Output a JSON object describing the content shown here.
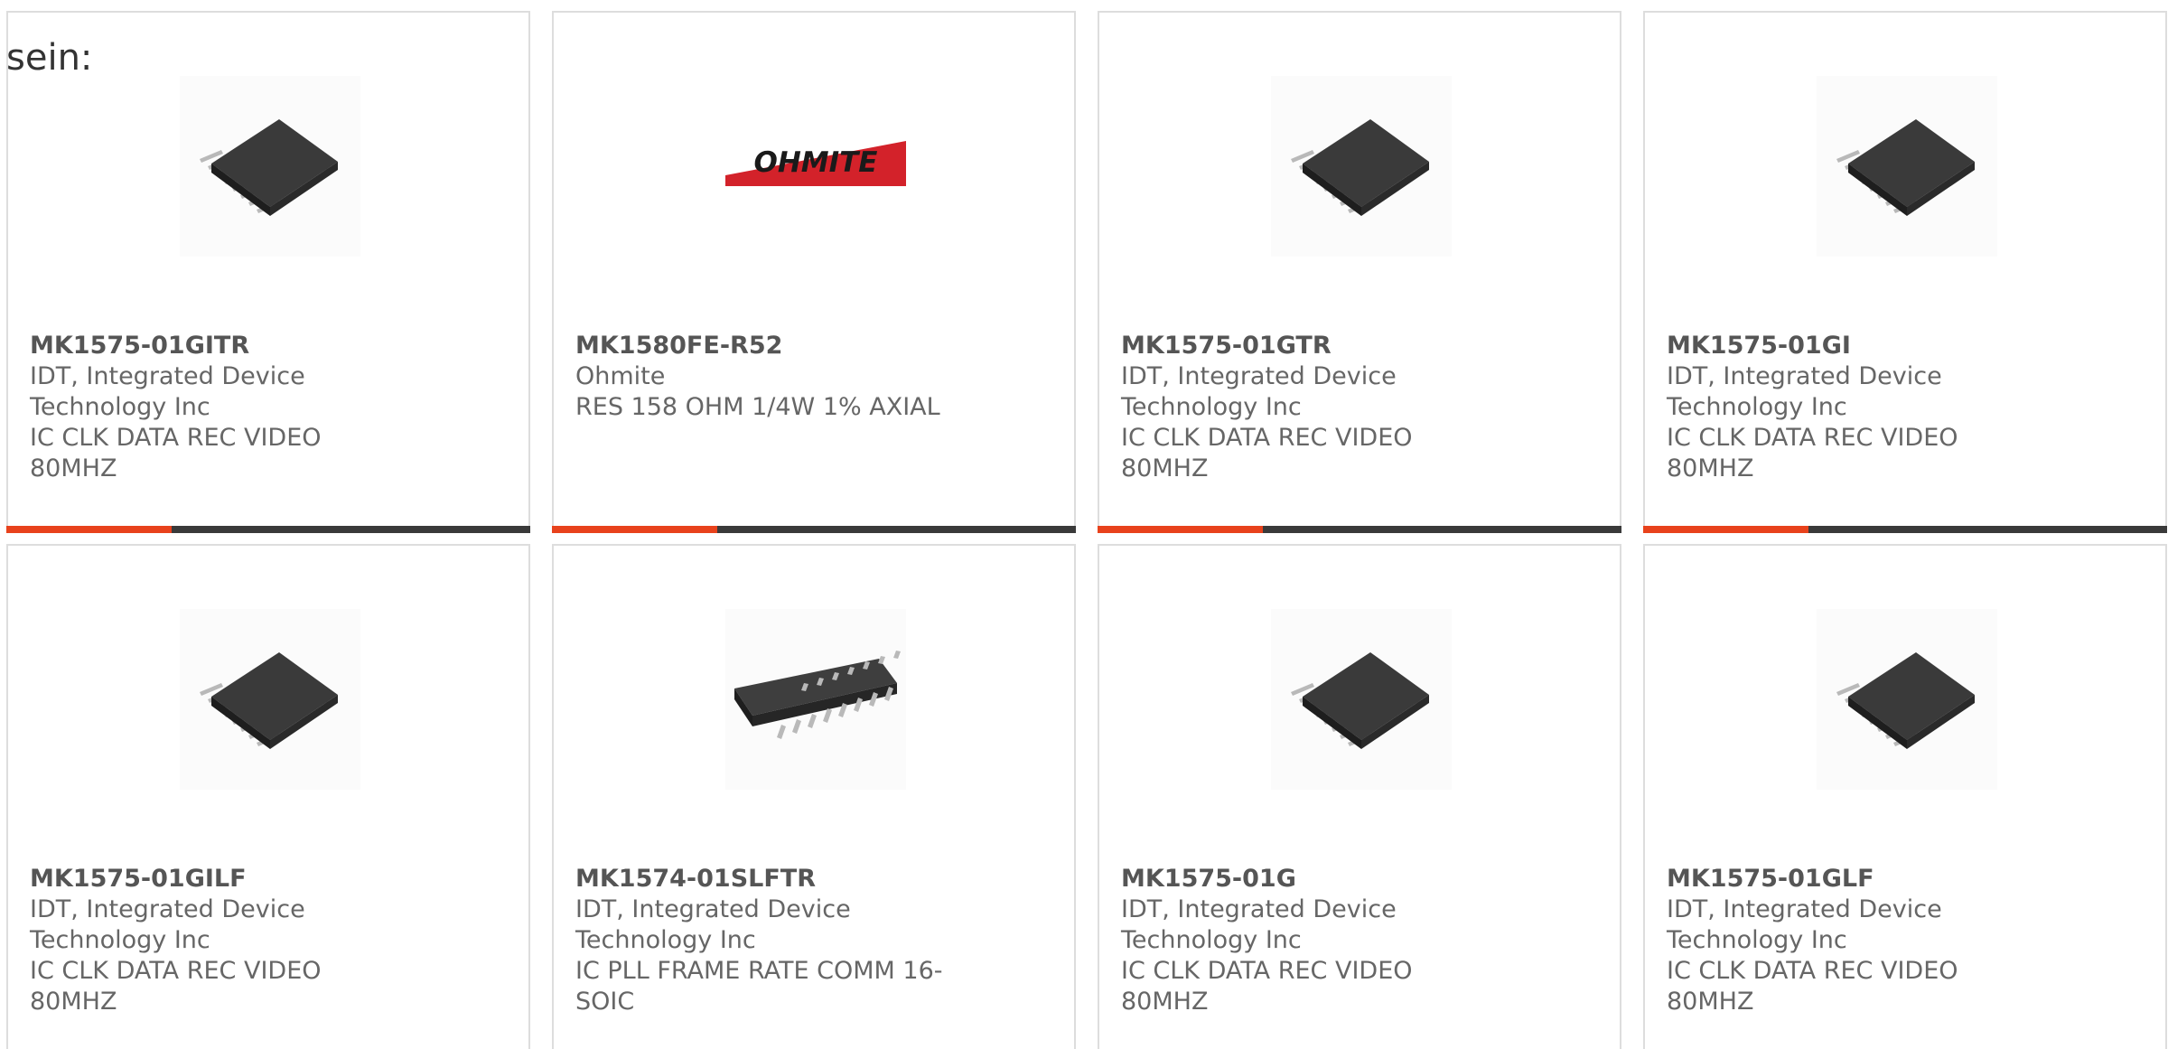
{
  "intro_text": "sein:",
  "colors": {
    "accent": "#e8421c",
    "bar": "#3a3a3a",
    "border": "#dddddd",
    "text": "#666666"
  },
  "cards": [
    {
      "part_number": "MK1575-01GITR",
      "manufacturer": "IDT, Integrated Device Technology Inc",
      "description": "IC CLK DATA REC VIDEO 80MHZ",
      "image": "tssop-chip-icon"
    },
    {
      "part_number": "MK1580FE-R52",
      "manufacturer": "Ohmite",
      "description": "RES 158 OHM 1/4W 1% AXIAL",
      "image": "ohmite-logo",
      "logo_text": "OHMITE"
    },
    {
      "part_number": "MK1575-01GTR",
      "manufacturer": "IDT, Integrated Device Technology Inc",
      "description": "IC CLK DATA REC VIDEO 80MHZ",
      "image": "tssop-chip-icon"
    },
    {
      "part_number": "MK1575-01GI",
      "manufacturer": "IDT, Integrated Device Technology Inc",
      "description": "IC CLK DATA REC VIDEO 80MHZ",
      "image": "tssop-chip-icon"
    },
    {
      "part_number": "MK1575-01GILF",
      "manufacturer": "IDT, Integrated Device Technology Inc",
      "description": "IC CLK DATA REC VIDEO 80MHZ",
      "image": "tssop-chip-icon"
    },
    {
      "part_number": "MK1574-01SLFTR",
      "manufacturer": "IDT, Integrated Device Technology Inc",
      "description": "IC PLL FRAME RATE COMM 16-SOIC",
      "image": "soic-chip-icon"
    },
    {
      "part_number": "MK1575-01G",
      "manufacturer": "IDT, Integrated Device Technology Inc",
      "description": "IC CLK DATA REC VIDEO 80MHZ",
      "image": "tssop-chip-icon"
    },
    {
      "part_number": "MK1575-01GLF",
      "manufacturer": "IDT, Integrated Device Technology Inc",
      "description": "IC CLK DATA REC VIDEO 80MHZ",
      "image": "tssop-chip-icon"
    }
  ]
}
